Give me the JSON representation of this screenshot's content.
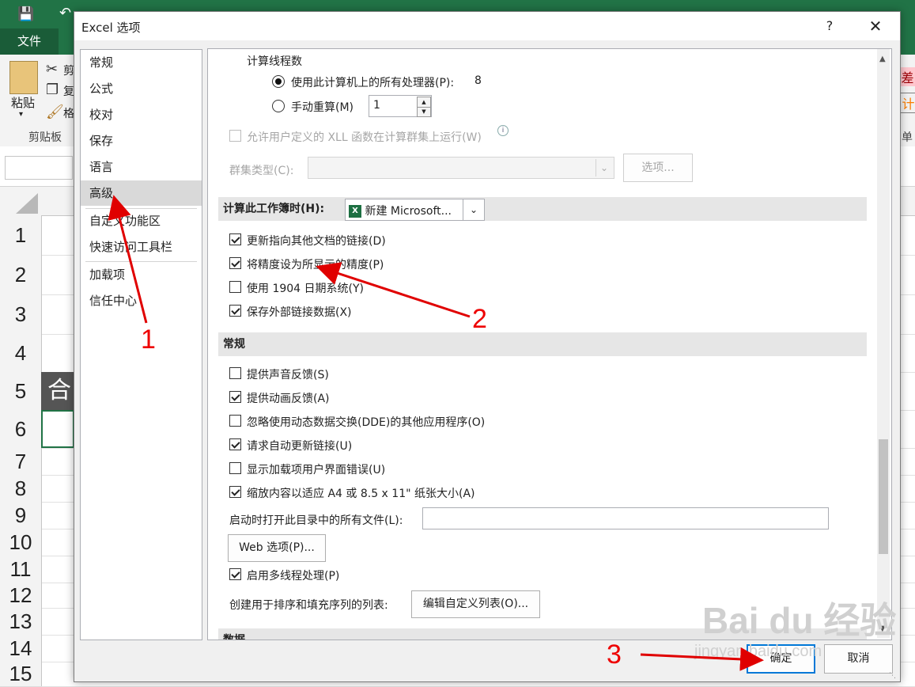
{
  "excel": {
    "file_tab": "文件",
    "paste_label": "粘贴",
    "cut_label": "剪",
    "copy_label": "复",
    "format_label": "格",
    "clipboard_group": "剪贴板",
    "right_partial_1": "差",
    "right_partial_2": "计",
    "right_partial_3": "单式",
    "row_numbers": [
      "1",
      "2",
      "3",
      "4",
      "5",
      "6",
      "7",
      "8",
      "9",
      "10",
      "11",
      "12",
      "13",
      "14",
      "15"
    ],
    "merged_cell_text": "合"
  },
  "dialog": {
    "title": "Excel 选项",
    "help": "?",
    "close": "✕",
    "nav": [
      "常规",
      "公式",
      "校对",
      "保存",
      "语言",
      "高级",
      "自定义功能区",
      "快速访问工具栏",
      "加载项",
      "信任中心"
    ],
    "selected_nav": "高级",
    "calc_threads": {
      "heading": "计算线程数",
      "use_all_label": "使用此计算机上的所有处理器(P):",
      "processor_count": "8",
      "manual_label": "手动重算(M)",
      "manual_value": "1"
    },
    "xll_label": "允许用户定义的 XLL 函数在计算群集上运行(W)",
    "cluster_type_label": "群集类型(C):",
    "options_button": "选项...",
    "workbook_section": {
      "label": "计算此工作簿时(H):",
      "workbook_name": "新建 Microsoft...",
      "items": [
        {
          "label": "更新指向其他文档的链接(D)",
          "checked": true
        },
        {
          "label": "将精度设为所显示的精度(P)",
          "checked": true
        },
        {
          "label": "使用 1904 日期系统(Y)",
          "checked": false
        },
        {
          "label": "保存外部链接数据(X)",
          "checked": true
        }
      ]
    },
    "general_section": {
      "label": "常规",
      "items": [
        {
          "label": "提供声音反馈(S)",
          "checked": false
        },
        {
          "label": "提供动画反馈(A)",
          "checked": true
        },
        {
          "label": "忽略使用动态数据交换(DDE)的其他应用程序(O)",
          "checked": false
        },
        {
          "label": "请求自动更新链接(U)",
          "checked": true
        },
        {
          "label": "显示加载项用户界面错误(U)",
          "checked": false
        },
        {
          "label": "缩放内容以适应 A4 或 8.5 x 11\" 纸张大小(A)",
          "checked": true
        }
      ],
      "startup_label": "启动时打开此目录中的所有文件(L):",
      "startup_value": "",
      "web_button": "Web 选项(P)...",
      "multithread_label": "启用多线程处理(P)",
      "multithread_checked": true,
      "custom_list_label": "创建用于排序和填充序列的列表:",
      "custom_list_button": "编辑自定义列表(O)..."
    },
    "data_section_label": "数据",
    "ok_button": "确定",
    "cancel_button": "取消"
  },
  "annotations": [
    "1",
    "2",
    "3"
  ],
  "watermark": {
    "brand": "Bai du 经验",
    "url": "jingyan.baidu.com"
  },
  "colors": {
    "excel_green": "#217346",
    "annotation_red": "#e00000"
  }
}
